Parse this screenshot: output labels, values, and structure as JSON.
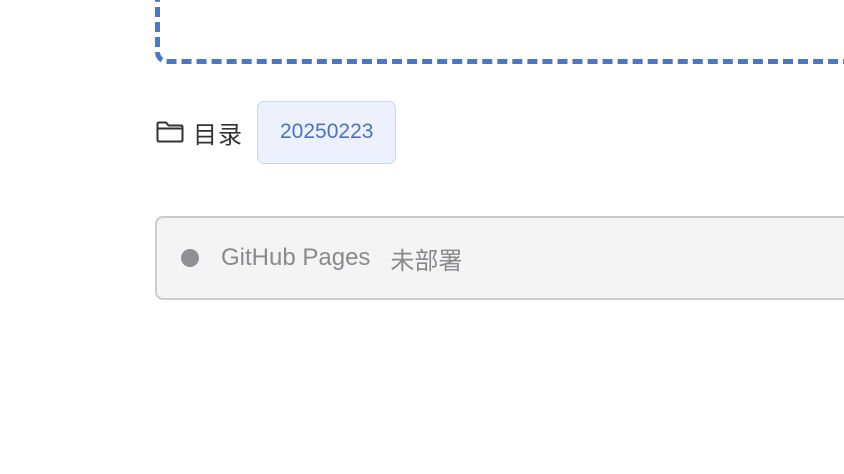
{
  "directory": {
    "label": "目录",
    "icon": "folder-icon",
    "value": "20250223"
  },
  "deploy_status": {
    "service": "GitHub Pages",
    "status": "未部署",
    "indicator_color": "#909094"
  },
  "colors": {
    "accent": "#4a78c6",
    "chip_bg": "#edf1fd",
    "chip_text": "#4a72c4"
  }
}
